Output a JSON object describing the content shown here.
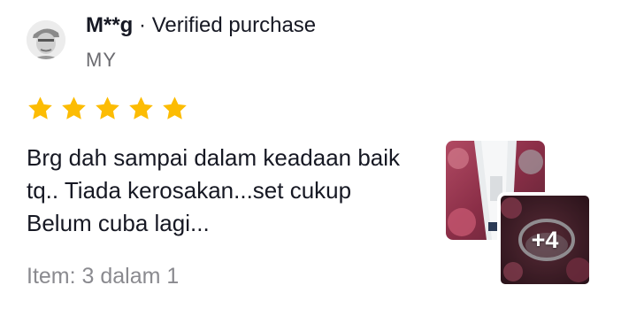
{
  "review": {
    "author": "M**g",
    "separator": "·",
    "verified_label": "Verified purchase",
    "region": "MY",
    "rating": 5,
    "max_rating": 5,
    "text": "Brg dah sampai dalam keadaan baik tq.. Tiada kerosakan...set cukup Belum cuba lagi...",
    "item_variant": "Item: 3 dalam 1",
    "more_photos_label": "+4"
  },
  "colors": {
    "star": "#fcbc03",
    "primary_text": "#161823",
    "secondary_text": "#8a8a8f"
  }
}
